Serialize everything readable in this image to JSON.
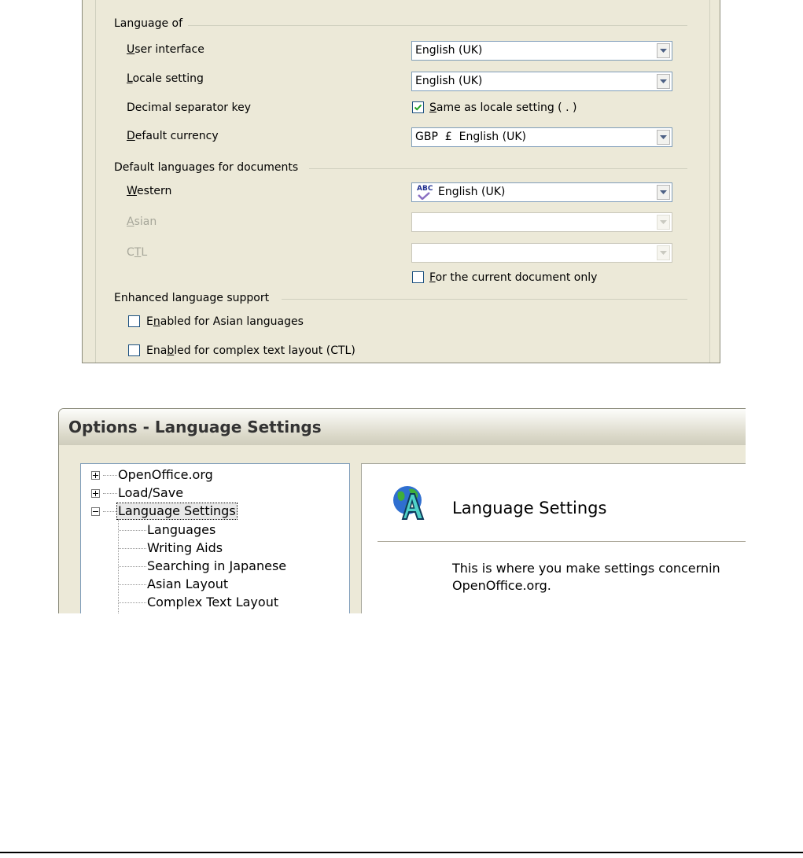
{
  "language_panel": {
    "section_language_of": "Language of",
    "user_interface": {
      "label": "User interface",
      "value": "English (UK)"
    },
    "locale_setting": {
      "label": "Locale setting",
      "value": "English (UK)"
    },
    "decimal_separator": {
      "label": "Decimal separator key",
      "checkbox_label": "Same as locale setting ( . )",
      "checked": true
    },
    "default_currency": {
      "label": "Default currency",
      "value": "GBP  £  English (UK)"
    },
    "section_default_languages": "Default languages for documents",
    "western": {
      "label": "Western",
      "value": "English (UK)",
      "icon": "spellcheck-abc-icon"
    },
    "asian": {
      "label": "Asian",
      "value": "",
      "disabled": true
    },
    "ctl": {
      "label": "CTL",
      "value": "",
      "disabled": true
    },
    "current_document_only": {
      "label": "For the current document only",
      "checked": false
    },
    "section_enhanced": "Enhanced language support",
    "asian_languages": {
      "label": "Enabled for Asian languages",
      "checked": false
    },
    "ctl_layout": {
      "label": "Enabled for complex text layout (CTL)",
      "checked": false
    }
  },
  "options_dialog": {
    "title": "Options - Language Settings",
    "tree": [
      {
        "label": "OpenOffice.org",
        "expander": "plus"
      },
      {
        "label": "Load/Save",
        "expander": "plus"
      },
      {
        "label": "Language Settings",
        "expander": "minus",
        "selected": true
      },
      {
        "label": "Languages"
      },
      {
        "label": "Writing Aids"
      },
      {
        "label": "Searching in Japanese"
      },
      {
        "label": "Asian Layout"
      },
      {
        "label": "Complex Text Layout"
      }
    ],
    "page_title": "Language Settings",
    "page_icon": "globe-letter-a-icon",
    "description_line1": "This is where you make settings concernin",
    "description_line2": "OpenOffice.org."
  }
}
